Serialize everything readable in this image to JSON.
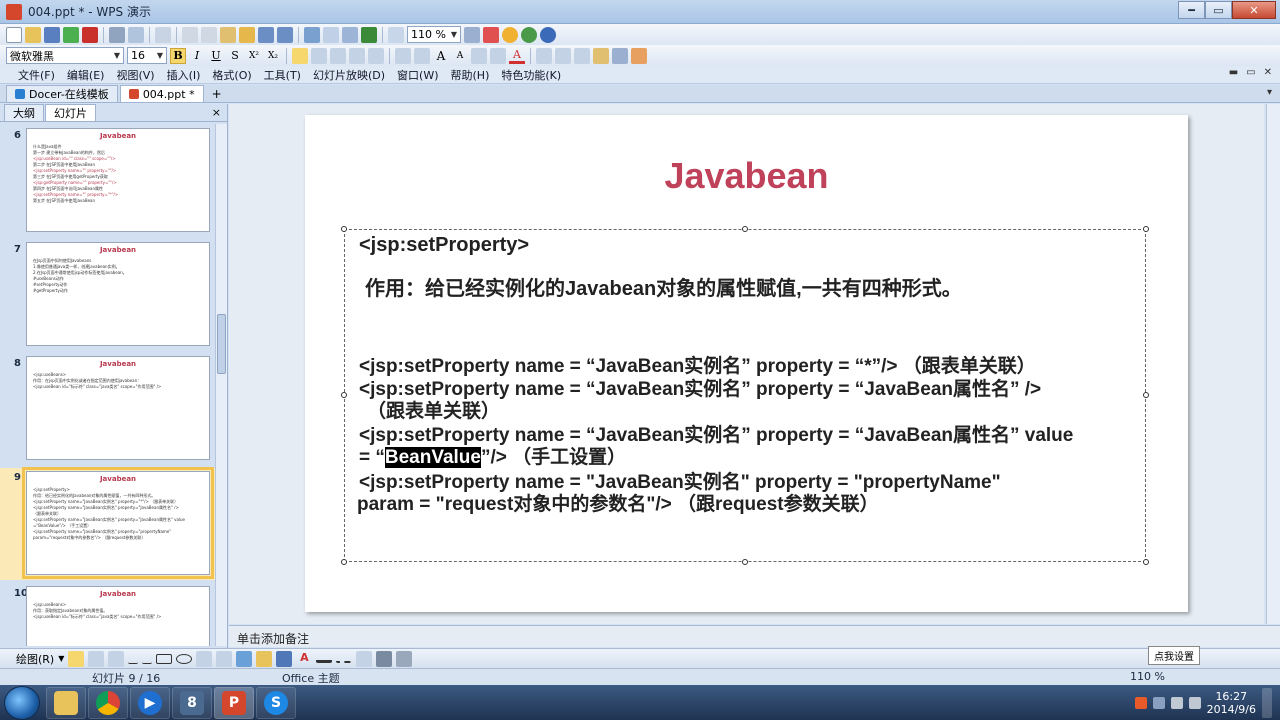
{
  "window": {
    "title": "004.ppt * - WPS 演示"
  },
  "toolbar1": {
    "zoom": "110 %"
  },
  "toolbar2": {
    "font_name": "微软雅黑",
    "font_size": "16",
    "bold": "B",
    "italic": "I",
    "underline": "U",
    "shadow": "S",
    "superscript": "X²",
    "subscript": "X₂",
    "grow_font": "A",
    "shrink_font": "A",
    "font_color": "A"
  },
  "menu": {
    "items": [
      "文件(F)",
      "编辑(E)",
      "视图(V)",
      "插入(I)",
      "格式(O)",
      "工具(T)",
      "幻灯片放映(D)",
      "窗口(W)",
      "帮助(H)",
      "特色功能(K)"
    ]
  },
  "tabs": {
    "docer": "Docer-在线模板",
    "doc": "004.ppt *",
    "new": "+"
  },
  "panel": {
    "tab_outline": "大纲",
    "tab_slides": "幻灯片",
    "close": "×"
  },
  "thumbnails": [
    {
      "num": "6",
      "title": "Javabean",
      "lines": [
        "什么是Java组件",
        "第一步 建立带有JavaBean的构件，然后",
        "<jsp:useBean id=\"\" class=\"\" scope=\"\"/>",
        "第二步 在JSP页面中使用JavaBean",
        "<jsp:setProperty name=\"\" property=\"\"/>",
        "第三步 在JSP页面中使用getProperty获取",
        "<jsp:getProperty name=\"\" property=\"\"/>",
        "第四步 在JSP页面中访问JavaBean属性",
        "<jsp:setProperty name=\"\" property=\"*\"/>",
        "第五步 在JSP页面中使用JavaBean"
      ]
    },
    {
      "num": "7",
      "title": "Javabean",
      "lines": [
        "在Jsp页面中如何使用Javabeans",
        "1.像使用普通java类一样，创建javabean实例。",
        "2.在Jsp页面中通常使用jsp动作标签使用javabean。",
        "",
        "#useBeans动作",
        "#setProperty动作",
        "#getProperty动作"
      ]
    },
    {
      "num": "8",
      "title": "Javabean",
      "lines": [
        "<jsp:useBeans>",
        "作用：在jsp页面中实例化或者在指定范围内使用javabean：",
        "<jsp:useBean id=\"标示符\" class=\"java类名\" scope=\"作用范围\" />"
      ]
    },
    {
      "num": "9",
      "title": "Javabean",
      "lines": [
        "<jsp:setProperty>",
        "作用：给已经实例化的Javabean对象的属性赋值，一共有四种形式。",
        "",
        "<jsp:setProperty name=\"JavaBean实例名\" property=\"*\"/> （跟表单关联）",
        "<jsp:setProperty name=\"JavaBean实例名\" property=\"JavaBean属性名\" />",
        "（跟表单关联）",
        "<jsp:setProperty name=\"JavaBean实例名\" property=\"JavaBean属性名\" value",
        "=\"BeanValue\"/> （手工设置）",
        "<jsp:setProperty name=\"JavaBean实例名\" property=\"propertyName\"",
        "param=\"request对象中的参数名\"/> （跟request参数关联）"
      ]
    },
    {
      "num": "10",
      "title": "Javabean",
      "lines": [
        "<jsp:useBeans>",
        "作用：获取指定Javabean对象的属性值。",
        "<jsp:useBean id=\"标示符\" class=\"java类名\" scope=\"作用范围\" />"
      ]
    }
  ],
  "slide": {
    "title": "Javabean",
    "heading": "<jsp:setProperty>",
    "purpose": "作用：给已经实例化的Javabean对象的属性赋值,一共有四种形式。",
    "form1": "<jsp:setProperty name = “JavaBean实例名” property = “*”/>   （跟表单关联）",
    "form2a": "<jsp:setProperty name = “JavaBean实例名” property = “JavaBean属性名” />",
    "form2b": "（跟表单关联）",
    "form3a": "<jsp:setProperty name = “JavaBean实例名” property = “JavaBean属性名” value",
    "form3b_pre": "= “",
    "form3b_sel": "BeanValue",
    "form3b_post": "”/> （手工设置）",
    "form4a": "<jsp:setProperty name = \"JavaBean实例名\"   property = \"propertyName\"",
    "form4b": "param = \"request对象中的参数名\"/> （跟request参数关联）"
  },
  "notes": {
    "placeholder": "单击添加备注"
  },
  "drawbar": {
    "label": "绘图(R)"
  },
  "status": {
    "slide_pos": "幻灯片 9 / 16",
    "theme": "Office 主题",
    "zoom": "110 %"
  },
  "tooltip": {
    "text": "点我设置"
  },
  "taskbar": {
    "time": "16:27",
    "date": "2014/9/6"
  },
  "colors": {
    "title": "#c0415a",
    "selection": "#f2c24e"
  }
}
